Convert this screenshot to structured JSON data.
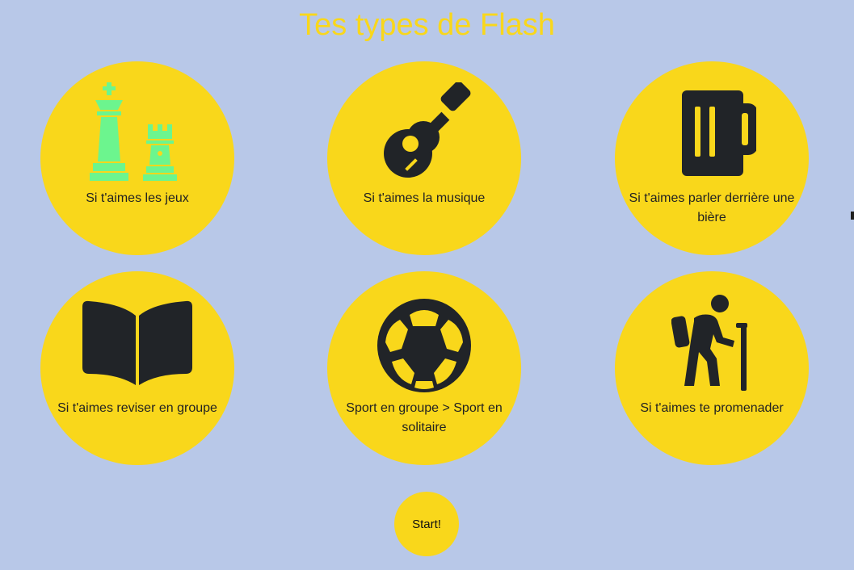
{
  "page": {
    "title": "Tes types de Flash",
    "colors": {
      "background": "#b8c8e8",
      "accent": "#f9d71b",
      "icon_dark": "#212428",
      "icon_green": "#6cf58e"
    }
  },
  "cards": [
    {
      "label": "Si t'aimes les jeux",
      "icon": "chess-icon"
    },
    {
      "label": "Si t'aimes la musique",
      "icon": "guitar-icon"
    },
    {
      "label": "Si t'aimes parler derrière une bière",
      "icon": "beer-mug-icon"
    },
    {
      "label": "Si t'aimes reviser en groupe",
      "icon": "open-book-icon"
    },
    {
      "label": "Sport en groupe > Sport en solitaire",
      "icon": "soccer-ball-icon"
    },
    {
      "label": "Si t'aimes te promenader",
      "icon": "hiker-icon"
    }
  ],
  "start_button": {
    "label": "Start!"
  }
}
